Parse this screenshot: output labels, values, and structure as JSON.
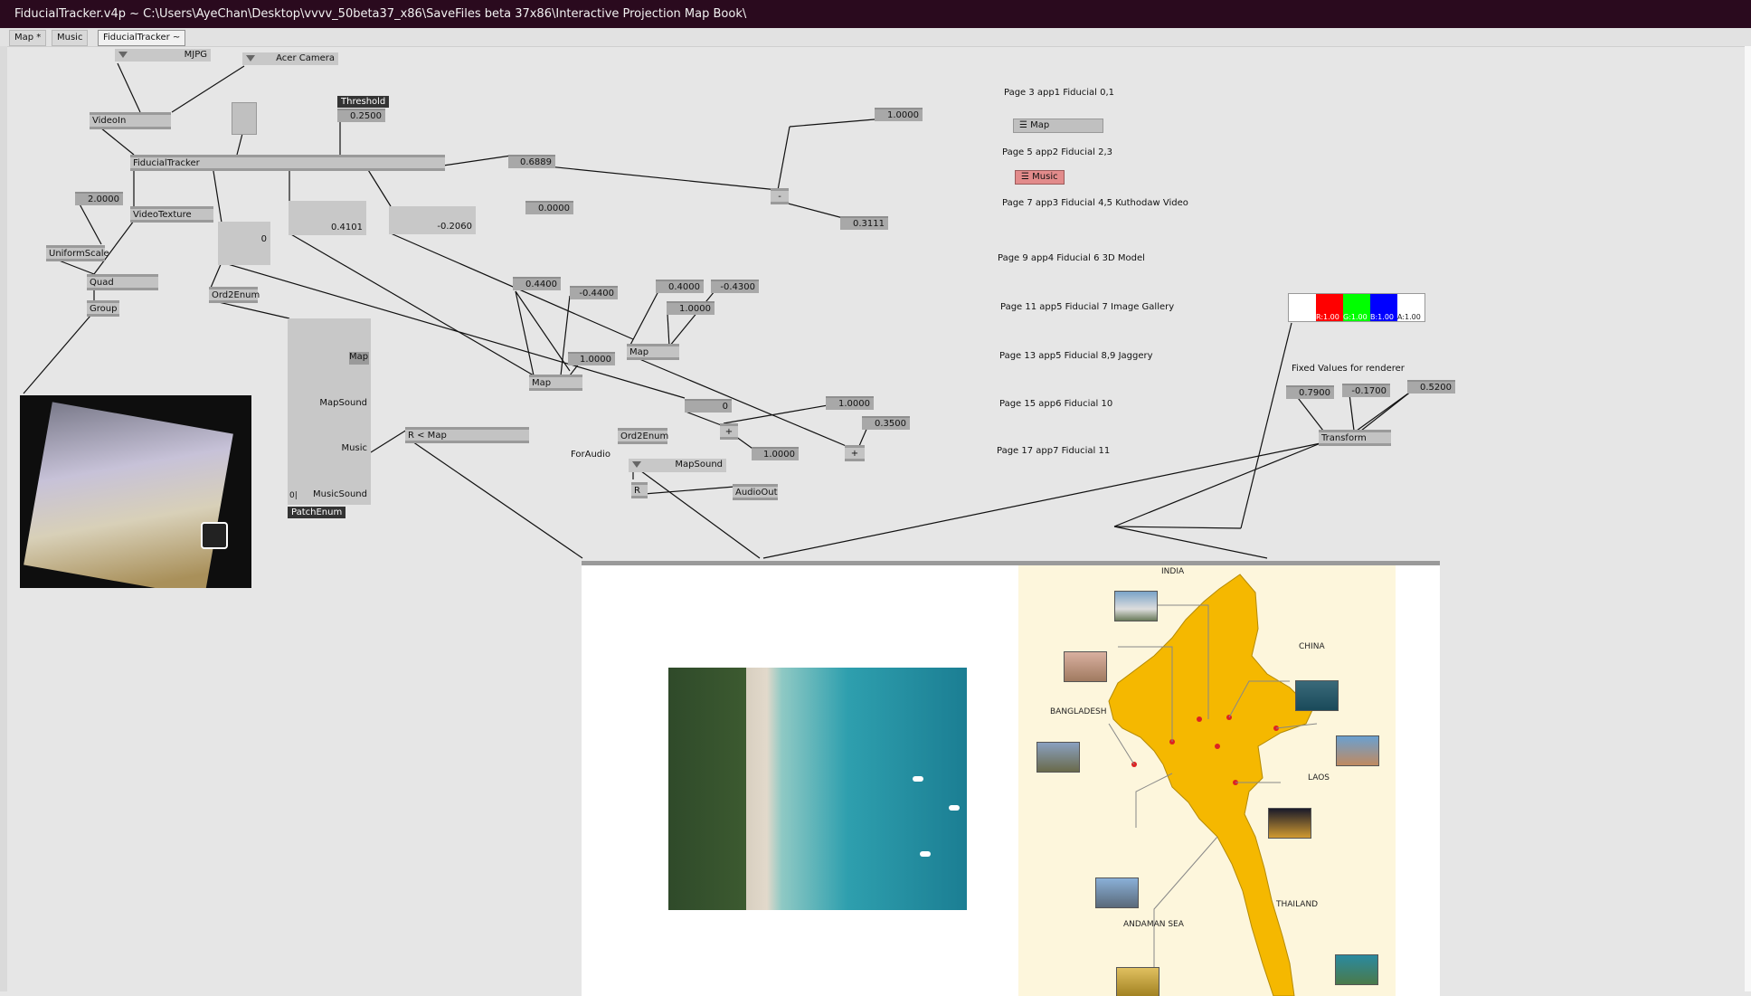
{
  "window": {
    "title": "FiducialTracker.v4p ~  C:\\Users\\AyeChan\\Desktop\\vvvv_50beta37_x86\\SaveFiles beta 37x86\\Interactive Projection Map Book\\"
  },
  "tabs": [
    {
      "label": "Map *"
    },
    {
      "label": "Music"
    },
    {
      "label": "FiducialTracker ~"
    }
  ],
  "nodes": {
    "mjpg": "MJPG",
    "acer_camera": "Acer Camera",
    "videoin": "VideoIn",
    "threshold_label": "Threshold",
    "threshold_value": "0.2500",
    "fiducialtracker": "FiducialTracker",
    "videotexture": "VideoTexture",
    "uniformscale": "UniformScale",
    "scale_value": "2.0000",
    "quad": "Quad",
    "group": "Group",
    "ord2enum_1": "Ord2Enum",
    "ord2enum_2": "Ord2Enum",
    "box_zero": "0",
    "val_0_4101": "0.4101",
    "val_neg_0_2060": "-0.2060",
    "val_0_6889": "0.6889",
    "val_0_0000": "0.0000",
    "val_1_0000_top": "1.0000",
    "val_0_3111": "0.3111",
    "val_0_4400": "0.4400",
    "val_neg_0_4400": "-0.4400",
    "val_1_0000_a": "1.0000",
    "map_a": "Map",
    "val_0_4000": "0.4000",
    "val_neg_0_4300": "-0.4300",
    "val_1_0000_b": "1.0000",
    "map_b": "Map",
    "val_zero_small": "0",
    "val_1_0000_c": "1.0000",
    "val_0_3500": "0.3500",
    "val_1_0000_d": "1.0000",
    "plus_1": "+",
    "plus_2": "+",
    "minus": "-",
    "patch_items": [
      "Map",
      "MapSound",
      "Music",
      "MusicSound"
    ],
    "patch_zero": "0|",
    "patchenum": "PatchEnum",
    "r_map": "R < Map",
    "for_audio": "ForAudio",
    "mapsound": "MapSound",
    "r_node": "R",
    "audioout": "AudioOut"
  },
  "pages": [
    "Page 3 app1 Fiducial 0,1",
    "Page 5 app2 Fiducial 2,3",
    "Page 7 app3 Fiducial 4,5 Kuthodaw Video",
    "Page 9 app4 Fiducial 6 3D Model",
    "Page 11 app5 Fiducial 7 Image Gallery",
    "Page 13 app5 Fiducial 8,9 Jaggery",
    "Page 15 app6 Fiducial 10",
    "Page 17 app7 Fiducial 11"
  ],
  "buttons": {
    "map": "Map",
    "music": "Music"
  },
  "color": {
    "r": "R:1.00",
    "g": "G:1.00",
    "b": "B:1.00",
    "a": "A:1.00",
    "swatch_white": "#ffffff",
    "swatch_red": "#ff0000",
    "swatch_green": "#00ff00",
    "swatch_blue": "#0000ff"
  },
  "fixed": {
    "label": "Fixed Values for renderer",
    "v1": "0.7900",
    "v2": "-0.1700",
    "v3": "0.5200",
    "transform": "Transform"
  },
  "map": {
    "countries": [
      "INDIA",
      "CHINA",
      "BANGLADESH",
      "LAOS",
      "THAILAND",
      "ANDAMAN SEA"
    ],
    "accent": "#f5b800"
  }
}
